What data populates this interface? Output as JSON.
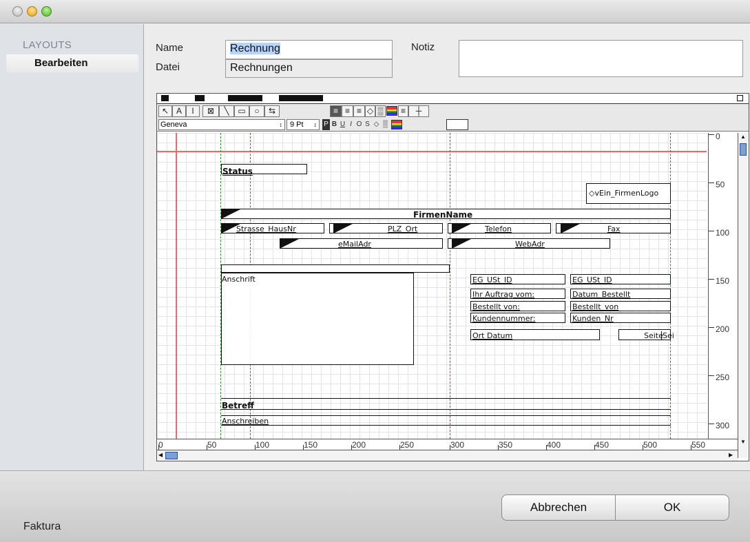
{
  "sidebar": {
    "heading": "LAYOUTS",
    "item": "Bearbeiten"
  },
  "form": {
    "name_label": "Name",
    "name_value": "Rechnung",
    "file_label": "Datei",
    "file_value": "Rechnungen",
    "note_label": "Notiz",
    "note_value": ""
  },
  "toolbar": {
    "font": "Geneva",
    "size": "9 Pt",
    "tools": [
      "arrow-icon",
      "text-tool-icon",
      "field-tool-icon",
      "picture-tool-icon",
      "line-tool-icon",
      "rect-tool-icon",
      "oval-tool-icon",
      "swap-icon"
    ]
  },
  "layout": {
    "status": "Status",
    "logo": "◇vEin_FirmenLogo",
    "firm": "FirmenName",
    "street": "Strasse_HausNr",
    "zip": "PLZ_Ort",
    "phone": "Telefon",
    "fax": "Fax",
    "email": "eMailAdr",
    "web": "WebAdr",
    "address": "Anschrift",
    "vat_label": "EG_USt_ID",
    "vat_value": "EG_USt_ID",
    "order_label": "Ihr Auftrag vom:",
    "order_value": "Datum_Bestellt",
    "orderer_label": "Bestellt von:",
    "orderer_value": "Bestellt_von",
    "customer_label": "Kundennummer:",
    "customer_value": "Kunden_Nr",
    "place_date": "Ort Datum",
    "page": "Seite",
    "page_cut": "Sei",
    "subject": "Betreff",
    "letter": "Anschreiben"
  },
  "ruler_right": [
    "0",
    "50",
    "100",
    "150",
    "200",
    "250",
    "300"
  ],
  "ruler_bottom": [
    "0",
    "50",
    "100",
    "150",
    "200",
    "250",
    "300",
    "350",
    "400",
    "450",
    "500",
    "550"
  ],
  "buttons": {
    "cancel": "Abbrechen",
    "ok": "OK"
  },
  "footer": "Faktura"
}
